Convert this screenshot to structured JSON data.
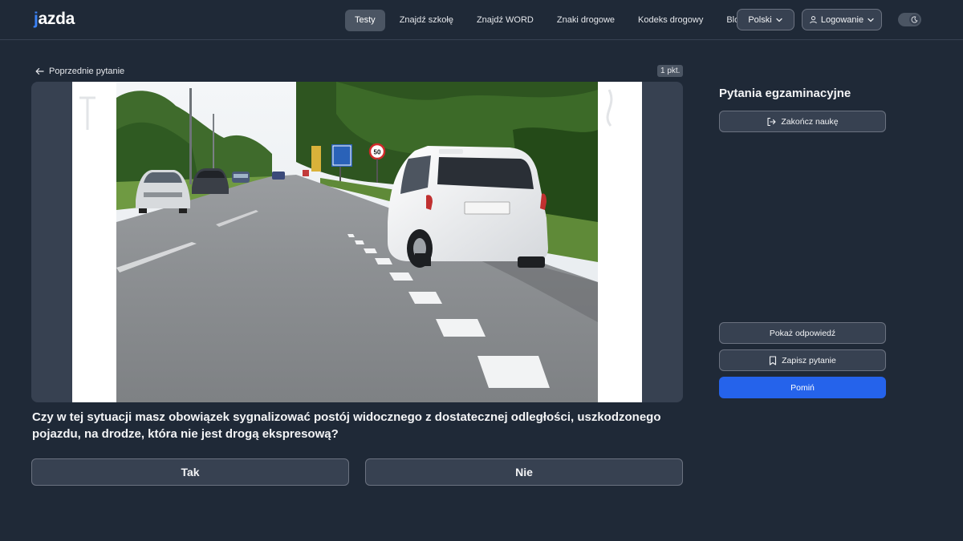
{
  "header": {
    "logo": "jazda",
    "nav": [
      {
        "label": "Testy",
        "active": true
      },
      {
        "label": "Znajdź szkołę"
      },
      {
        "label": "Znajdź WORD"
      },
      {
        "label": "Znaki drogowe"
      },
      {
        "label": "Kodeks drogowy"
      },
      {
        "label": "Blog"
      }
    ],
    "language": "Polski",
    "login": "Logowanie",
    "theme_icon": "moon-icon"
  },
  "question": {
    "back_label": "Poprzednie pytanie",
    "points": "1 pkt.",
    "text": "Czy w tej sytuacji masz obowiązek sygnalizować postój widocznego z dostatecznej odległości, uszkodzonego pojazdu, na drodze, która nie jest drogą ekspresową?",
    "answers": [
      "Tak",
      "Nie"
    ],
    "image_sign_text": "50"
  },
  "sidebar": {
    "title": "Pytania egzaminacyjne",
    "finish": "Zakończ naukę",
    "show_answer": "Pokaż odpowiedź",
    "save_question": "Zapisz pytanie",
    "skip": "Pomiń"
  },
  "colors": {
    "background": "#1f2937",
    "panel": "#374151",
    "accent": "#2563eb",
    "logo_accent": "#3b82f6"
  }
}
